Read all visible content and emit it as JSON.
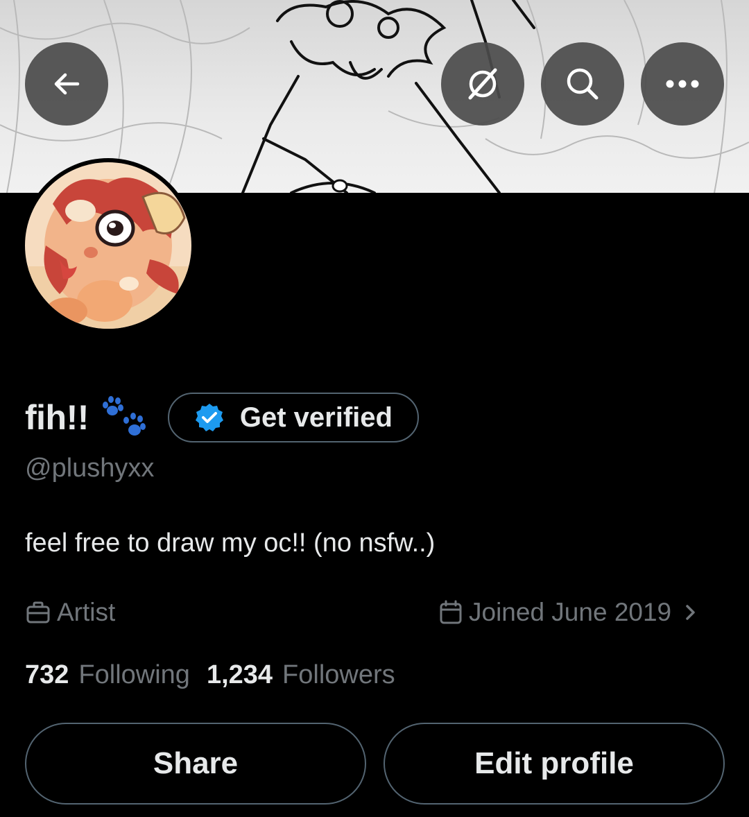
{
  "header": {
    "back_icon": "arrow-left-icon",
    "grok_icon": "grok-icon",
    "search_icon": "search-icon",
    "more_icon": "more-horizontal-icon"
  },
  "profile": {
    "display_name": "fih!!",
    "name_emoji": "paw-prints-icon",
    "handle": "@plushyxx",
    "bio": "feel free to draw my oc!! (no nsfw..)",
    "profession": "Artist",
    "joined": "Joined June 2019",
    "following_count": "732",
    "following_label": "Following",
    "followers_count": "1,234",
    "followers_label": "Followers"
  },
  "verify": {
    "label": "Get verified"
  },
  "actions": {
    "share_label": "Share",
    "edit_label": "Edit profile"
  },
  "colors": {
    "background": "#000000",
    "primary_text": "#e7e9ea",
    "secondary_text": "#71767b",
    "border": "#536471",
    "verified_blue": "#1d9bf0",
    "paw_blue": "#2f6fd6"
  }
}
